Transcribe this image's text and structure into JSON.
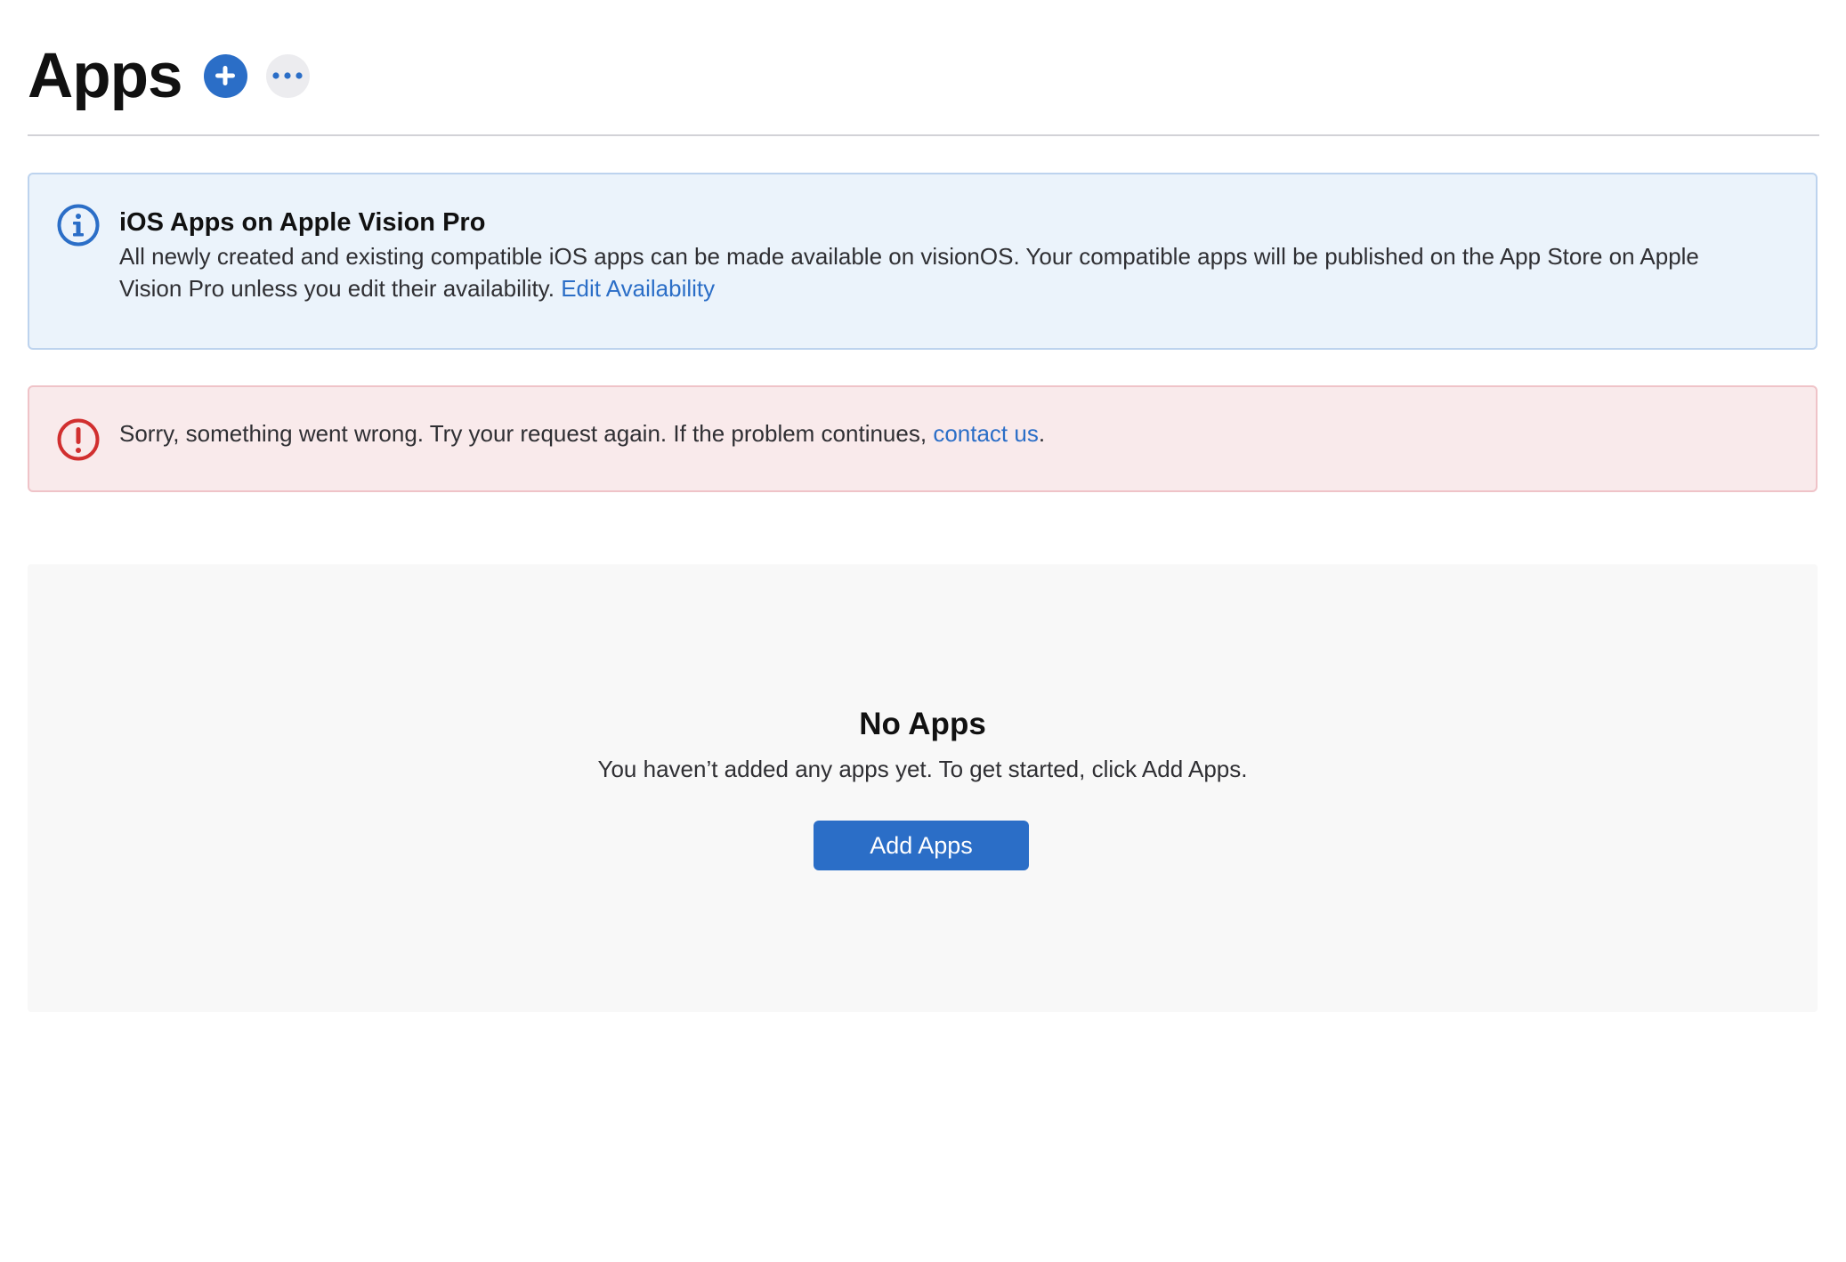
{
  "header": {
    "title": "Apps",
    "add_icon": "plus-icon",
    "more_icon": "ellipsis-icon"
  },
  "info_alert": {
    "icon": "info-icon",
    "title": "iOS Apps on Apple Vision Pro",
    "body": "All newly created and existing compatible iOS apps can be made available on visionOS. Your compatible apps will be published on the App Store on Apple Vision Pro unless you edit their availability.",
    "link_label": "Edit Availability"
  },
  "error_alert": {
    "icon": "exclamation-icon",
    "body": "Sorry, something went wrong. Try your request again. If the problem continues,",
    "link_label": "contact us",
    "trailing": "."
  },
  "empty_state": {
    "title": "No Apps",
    "description": "You haven’t added any apps yet. To get started, click Add Apps.",
    "button_label": "Add Apps"
  },
  "colors": {
    "accent": "#2b6ec7",
    "info_background": "#ebf3fb",
    "error_background": "#f9eaeb",
    "error_accent": "#d12f2f"
  }
}
